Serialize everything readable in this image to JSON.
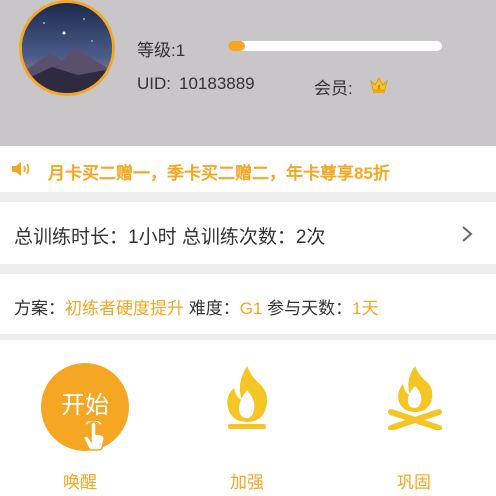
{
  "profile": {
    "level_label": "等级:1",
    "level_progress": 0.08,
    "uid_label": "UID:",
    "uid_value": "10183889",
    "vip_label": "会员:"
  },
  "notice": {
    "text": "月卡买二赠一，季卡买二赠二，年卡尊享85折",
    "icon": "speaker-icon"
  },
  "stats": {
    "text": "总训练时长：1小时 总训练次数：2次"
  },
  "plan": {
    "plan_label": "方案：",
    "plan_value": "初练者硬度提升",
    "difficulty_label": " 难度：",
    "difficulty_value": "G1",
    "days_label": " 参与天数：",
    "days_value": "1天"
  },
  "actions": [
    {
      "label": "唤醒",
      "button_text": "开始",
      "icon": "hand-tap-icon"
    },
    {
      "label": "加强",
      "icon": "flame-icon"
    },
    {
      "label": "巩固",
      "icon": "campfire-icon"
    }
  ],
  "colors": {
    "accent": "#f5a623",
    "header_bg": "#c8c6c8",
    "divider": "#eeeeee",
    "text": "#333333"
  }
}
